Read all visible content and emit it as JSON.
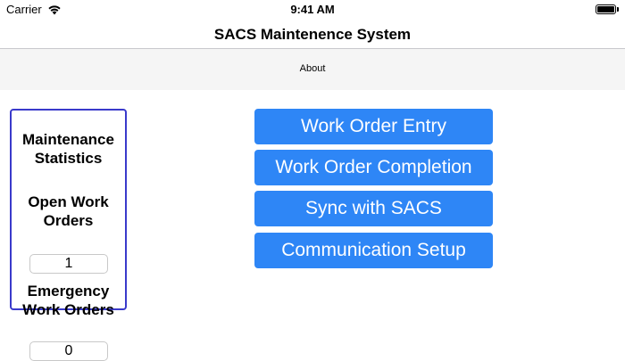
{
  "status_bar": {
    "carrier": "Carrier",
    "time": "9:41 AM"
  },
  "nav": {
    "title": "SACS Maintenence System"
  },
  "toolbar": {
    "about_label": "About"
  },
  "stats": {
    "title": "Maintenance Statistics",
    "open_label": "Open Work Orders",
    "open_value": "1",
    "emergency_label": "Emergency Work Orders",
    "emergency_value": "0"
  },
  "menu": {
    "work_order_entry": "Work Order Entry",
    "work_order_completion": "Work Order Completion",
    "sync": "Sync with SACS",
    "communication_setup": "Communication Setup"
  },
  "colors": {
    "accent": "#2e86f6",
    "panel_border": "#3a3acb"
  }
}
